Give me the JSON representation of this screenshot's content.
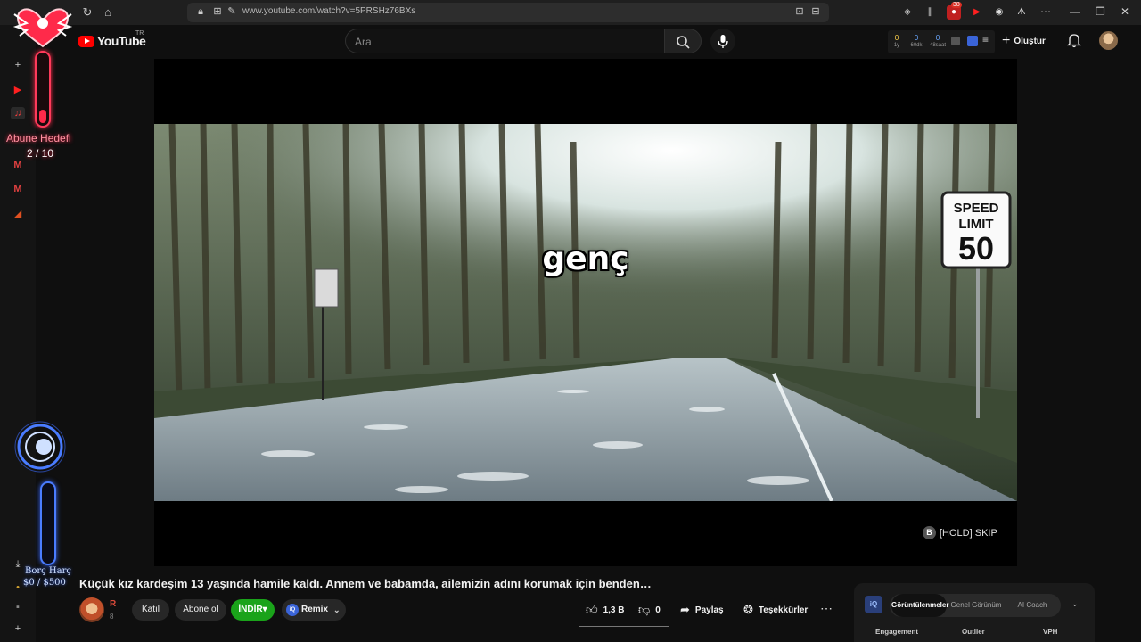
{
  "browser": {
    "url": "www.youtube.com/watch?v=5PRSHz76BXs",
    "extension_badge": "38"
  },
  "header": {
    "logo_text": "YouTube",
    "region": "TR",
    "search_placeholder": "Ara",
    "stats": [
      {
        "value": "0",
        "label": "1y"
      },
      {
        "value": "0",
        "label": "60dk"
      },
      {
        "value": "0",
        "label": "48saat"
      }
    ],
    "create_label": "Oluştur"
  },
  "overlay": {
    "goal_title": "Abune Hedefi",
    "goal_count": "2 / 10",
    "goal_progress": 0.2,
    "debt_title": "Borç Harç",
    "debt_value": "$0 / $500",
    "debt_progress": 0.0
  },
  "video": {
    "caption": "genç",
    "sign_line1": "SPEED",
    "sign_line2": "LIMIT",
    "sign_value": "50",
    "skip_key": "B",
    "skip_label": "[HOLD] SKIP",
    "title": "Küçük kız kardeşim 13 yaşında hamile kaldı. Annem ve babamda, ailemizin adını korumak için benden…"
  },
  "channel": {
    "name": "R",
    "subs": "8",
    "join_label": "Katıl",
    "subscribe_label": "Abone ol",
    "download_label": "İNDİR",
    "remix_label": "Remix"
  },
  "actions": {
    "likes": "1,3 B",
    "dislikes": "0",
    "share_label": "Paylaş",
    "thanks_label": "Teşekkürler"
  },
  "panel": {
    "tabs": [
      "Görüntülenmeler",
      "Genel Görünüm",
      "AI Coach"
    ],
    "active_tab": 0,
    "columns": [
      "Engagement",
      "Outlier",
      "VPH"
    ]
  },
  "colors": {
    "youtube_red": "#ff0000",
    "download_green": "#1aa31a",
    "goal_neon": "#ff2a4a",
    "debt_neon": "#3a6aff"
  }
}
